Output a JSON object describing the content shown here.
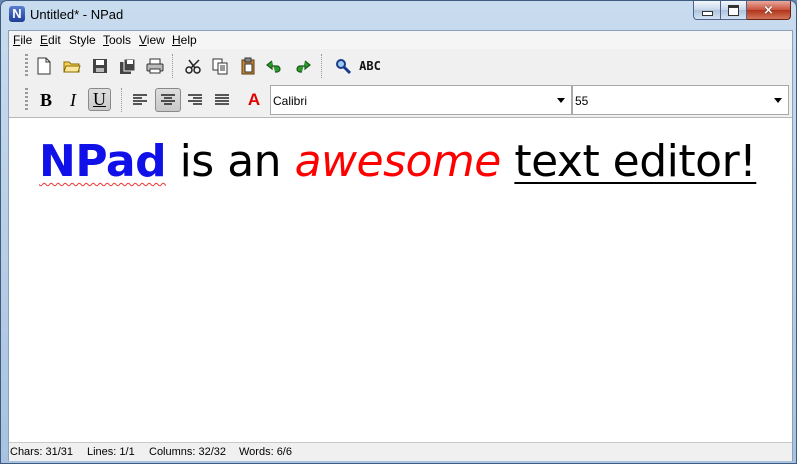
{
  "window": {
    "app_icon_letter": "N",
    "title": "Untitled* - NPad",
    "close_glyph": "×"
  },
  "menu": {
    "file": {
      "underlined": "F",
      "rest": "ile"
    },
    "edit": {
      "underlined": "E",
      "rest": "dit"
    },
    "style": {
      "underlined": "",
      "rest": "Style"
    },
    "tools": {
      "underlined": "T",
      "rest": "ools"
    },
    "view": {
      "underlined": "V",
      "rest": "iew"
    },
    "help": {
      "underlined": "H",
      "rest": "elp"
    }
  },
  "toolbar": {
    "icons": [
      "new-document-icon",
      "open-folder-icon",
      "save-icon",
      "save-all-icon",
      "print-icon",
      "cut-icon",
      "copy-icon",
      "paste-icon",
      "undo-icon",
      "redo-icon",
      "find-icon",
      "spellcheck-icon"
    ],
    "spellcheck_label": "ABC"
  },
  "format_bar": {
    "bold_label": "B",
    "italic_label": "I",
    "underline_label": "U",
    "font_color_label": "A",
    "font_color": "#e00000",
    "font_name": "Calibri",
    "font_size": "55",
    "active_alignment": "center"
  },
  "document": {
    "word1": "NPad",
    "space1": " ",
    "word2": "is an",
    "space2": " ",
    "word3": "awesome",
    "space3": " ",
    "word4": "text editor!",
    "colors": {
      "word1": "#1010e8",
      "word3": "#ff0000",
      "text": "#000000"
    }
  },
  "status": {
    "chars": "Chars: 31/31",
    "lines": "Lines: 1/1",
    "columns": "Columns: 32/32",
    "words": "Words: 6/6"
  }
}
